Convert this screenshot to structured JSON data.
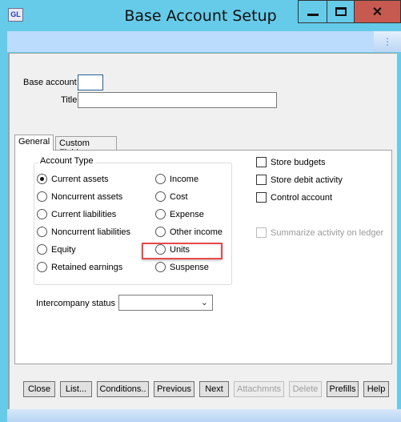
{
  "window": {
    "title": "Base Account Setup",
    "icon_text": "GL",
    "icon": "gl-app-icon",
    "controls": {
      "minimize": "minimize-icon",
      "maximize": "maximize-icon",
      "close": "close-icon"
    }
  },
  "form": {
    "base_account_label": "Base account",
    "base_account_value": "",
    "title_label": "Title",
    "title_value": ""
  },
  "tabs": [
    {
      "label": "General",
      "active": true
    },
    {
      "label": "Custom Fields",
      "active": false
    }
  ],
  "account_type": {
    "legend": "Account Type",
    "selected": "Current assets",
    "options_left": [
      "Current assets",
      "Noncurrent assets",
      "Current liabilities",
      "Noncurrent liabilities",
      "Equity",
      "Retained earnings"
    ],
    "options_right": [
      "Income",
      "Cost",
      "Expense",
      "Other income",
      "Units",
      "Suspense"
    ],
    "highlighted": "Units",
    "highlight_color": "#e84b4b"
  },
  "checkboxes": [
    {
      "label": "Store budgets",
      "checked": false,
      "enabled": true
    },
    {
      "label": "Store debit activity",
      "checked": false,
      "enabled": true
    },
    {
      "label": "Control account",
      "checked": false,
      "enabled": true
    },
    {
      "label": "Summarize activity on ledger",
      "checked": false,
      "enabled": false
    }
  ],
  "intercompany": {
    "label": "Intercompany status",
    "value": ""
  },
  "buttons": [
    {
      "label": "Close",
      "enabled": true
    },
    {
      "label": "List...",
      "enabled": true
    },
    {
      "label": "Conditions..",
      "enabled": true
    },
    {
      "label": "Previous",
      "enabled": true
    },
    {
      "label": "Next",
      "enabled": true
    },
    {
      "label": "Attachmnts",
      "enabled": false
    },
    {
      "label": "Delete",
      "enabled": false
    },
    {
      "label": "Prefills",
      "enabled": true
    },
    {
      "label": "Help",
      "enabled": true
    }
  ],
  "colors": {
    "title_bar": "#66cbe9",
    "toolbar": "#bcdcfd",
    "close_button": "#c75a50"
  }
}
